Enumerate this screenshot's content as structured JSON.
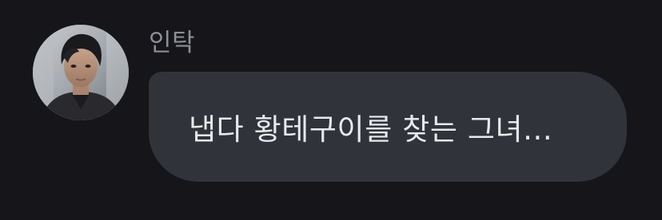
{
  "message": {
    "sender_name": "인탁",
    "text": "냅다 황테구이를 찾는 그녀...",
    "avatar_icon": "user-avatar-photo"
  },
  "colors": {
    "background": "#15151a",
    "bubble": "#31333b",
    "name_text": "#8d8f96",
    "message_text": "#e8e9ec"
  }
}
